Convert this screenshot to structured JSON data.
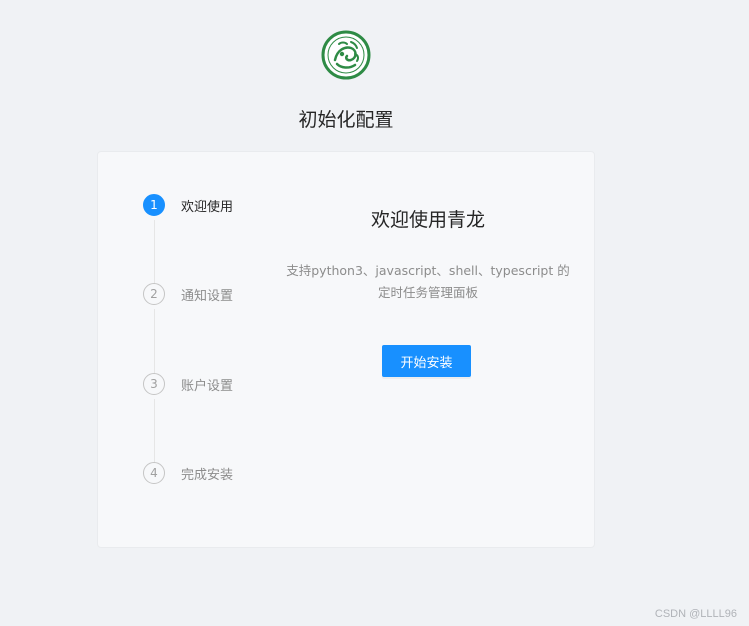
{
  "logo": {
    "icon": "qinglong-dragon-logo-icon",
    "color": "#2e8b45"
  },
  "page_title": "初始化配置",
  "steps": [
    {
      "number": "1",
      "label": "欢迎使用",
      "status": "active"
    },
    {
      "number": "2",
      "label": "通知设置",
      "status": "wait"
    },
    {
      "number": "3",
      "label": "账户设置",
      "status": "wait"
    },
    {
      "number": "4",
      "label": "完成安装",
      "status": "wait"
    }
  ],
  "content": {
    "heading": "欢迎使用青龙",
    "description_line1": "支持python3、javascript、shell、typescript 的",
    "description_line2": "定时任务管理面板",
    "start_button_label": "开始安装"
  },
  "watermark": "CSDN @LLLL96",
  "colors": {
    "primary": "#1890ff",
    "background": "#f0f2f5",
    "card": "#f7f8fa"
  }
}
